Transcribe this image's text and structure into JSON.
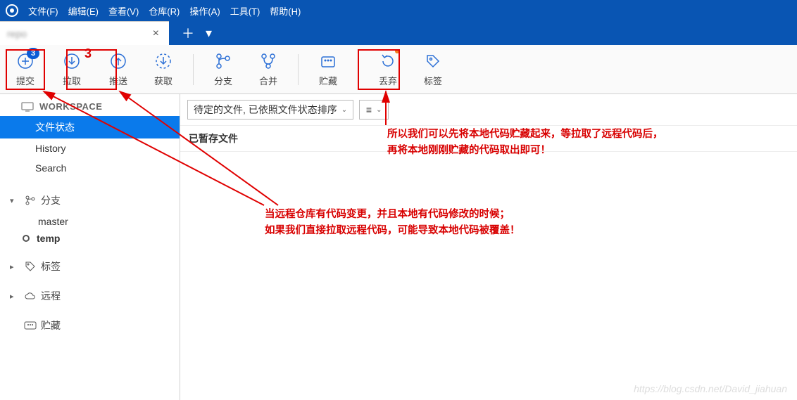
{
  "menu": {
    "file": "文件(F)",
    "edit": "编辑(E)",
    "view": "查看(V)",
    "repo": "仓库(R)",
    "action": "操作(A)",
    "tools": "工具(T)",
    "help": "帮助(H)"
  },
  "tab": {
    "title": "repo",
    "close": "×"
  },
  "tab_actions": {
    "add": "＋",
    "more": "▾"
  },
  "toolbar": {
    "commit": {
      "label": "提交",
      "badge": "3"
    },
    "pull": {
      "label": "拉取",
      "badge": "3"
    },
    "push": {
      "label": "推送"
    },
    "fetch": {
      "label": "获取"
    },
    "branch": {
      "label": "分支"
    },
    "merge": {
      "label": "合并"
    },
    "stash": {
      "label": "贮藏"
    },
    "discard": {
      "label": "丢弃"
    },
    "tag": {
      "label": "标签"
    }
  },
  "sidebar": {
    "workspace_label": "WORKSPACE",
    "items": {
      "filestatus": "文件状态",
      "history": "History",
      "search": "Search"
    },
    "sections": {
      "branches": "分支",
      "tags": "标签",
      "remotes": "远程",
      "stashes": "贮藏"
    },
    "branch_list": {
      "master": "master",
      "temp": "temp"
    }
  },
  "main": {
    "sort_select": "待定的文件, 已依照文件状态排序",
    "view_select": "≡",
    "staged_label": "已暂存文件"
  },
  "annotations": {
    "top1": "所以我们可以先将本地代码贮藏起来，等拉取了远程代码后，",
    "top2": "再将本地刚刚贮藏的代码取出即可！",
    "mid1": "当远程仓库有代码变更，并且本地有代码修改的时候；",
    "mid2": "如果我们直接拉取远程代码，可能导致本地代码被覆盖！"
  },
  "watermark": "https://blog.csdn.net/David_jiahuan"
}
